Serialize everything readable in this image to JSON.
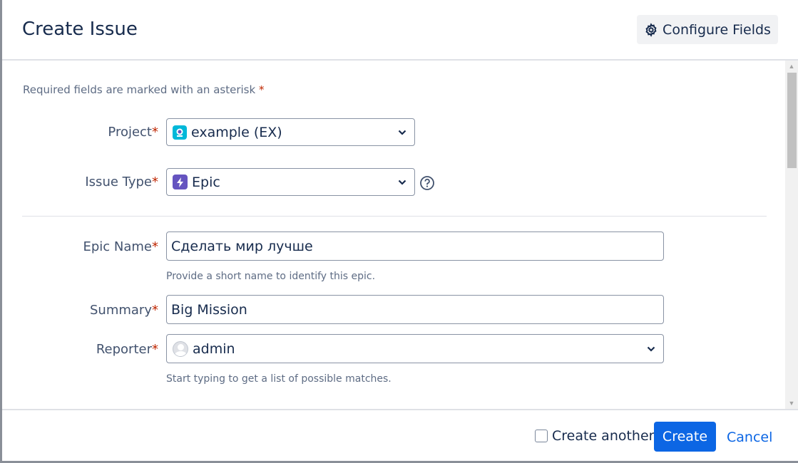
{
  "header": {
    "title": "Create Issue",
    "configure_label": "Configure Fields"
  },
  "form": {
    "required_note": "Required fields are marked with an asterisk",
    "required_mark": "*",
    "project": {
      "label": "Project",
      "value": "example (EX)"
    },
    "issue_type": {
      "label": "Issue Type",
      "value": "Epic"
    },
    "epic_name": {
      "label": "Epic Name",
      "value": "Сделать мир лучше",
      "help": "Provide a short name to identify this epic."
    },
    "summary": {
      "label": "Summary",
      "value": "Big Mission"
    },
    "reporter": {
      "label": "Reporter",
      "value": "admin",
      "help": "Start typing to get a list of possible matches."
    }
  },
  "footer": {
    "create_another_label": "Create another",
    "create_label": "Create",
    "cancel_label": "Cancel"
  },
  "colors": {
    "accent": "#0c66e4",
    "required": "#bf2600",
    "epic": "#6554c0",
    "project": "#00b8d9"
  }
}
